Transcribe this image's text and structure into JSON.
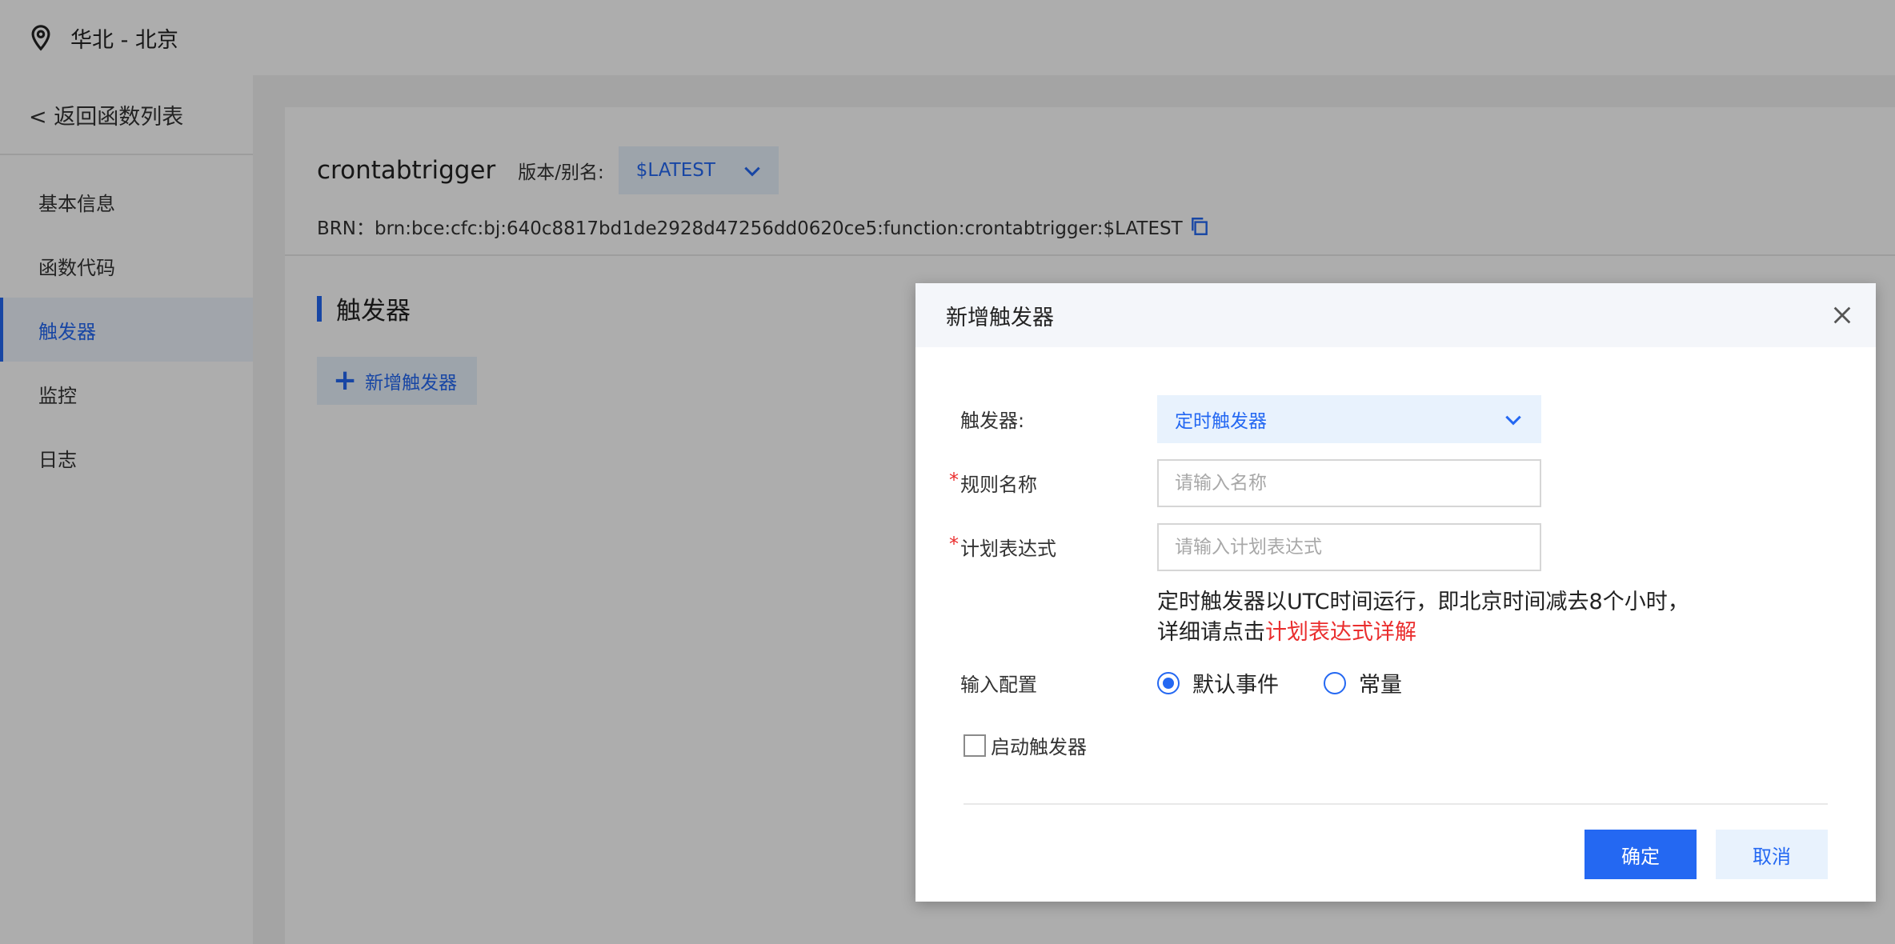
{
  "header": {
    "region": "华北 - 北京"
  },
  "sidebar": {
    "back_label": "< 返回函数列表",
    "items": [
      {
        "label": "基本信息",
        "active": false
      },
      {
        "label": "函数代码",
        "active": false
      },
      {
        "label": "触发器",
        "active": true
      },
      {
        "label": "监控",
        "active": false
      },
      {
        "label": "日志",
        "active": false
      }
    ]
  },
  "function": {
    "name": "crontabtrigger",
    "version_label": "版本/别名:",
    "version_value": "$LATEST",
    "brn": "BRN：brn:bce:cfc:bj:640c8817bd1de2928d47256dd0620ce5:function:crontabtrigger:$LATEST"
  },
  "section": {
    "title": "触发器",
    "add_button": "新增触发器"
  },
  "dialog": {
    "title": "新增触发器",
    "trigger_label": "触发器:",
    "trigger_value": "定时触发器",
    "rule_name_label": "规则名称",
    "rule_name_placeholder": "请输入名称",
    "schedule_label": "计划表达式",
    "schedule_placeholder": "请输入计划表达式",
    "hint_line1": "定时触发器以UTC时间运行，即北京时间减去8个小时，",
    "hint_line2_prefix": "详细请点击",
    "hint_link": "计划表达式详解",
    "input_config_label": "输入配置",
    "radio_default": "默认事件",
    "radio_constant": "常量",
    "radio_selected": "默认事件",
    "enable_label": "启动触发器",
    "enable_checked": false,
    "ok_label": "确定",
    "cancel_label": "取消"
  },
  "colors": {
    "accent": "#2468f2",
    "accent_light": "#e8f2fd",
    "required": "#ea2e2e",
    "overlay": "rgba(0,0,0,0.32)"
  },
  "icons": {
    "location": "location-pin-icon",
    "chevron": "chevron-down-icon",
    "copy": "copy-icon",
    "close": "close-icon",
    "plus": "plus-icon"
  }
}
